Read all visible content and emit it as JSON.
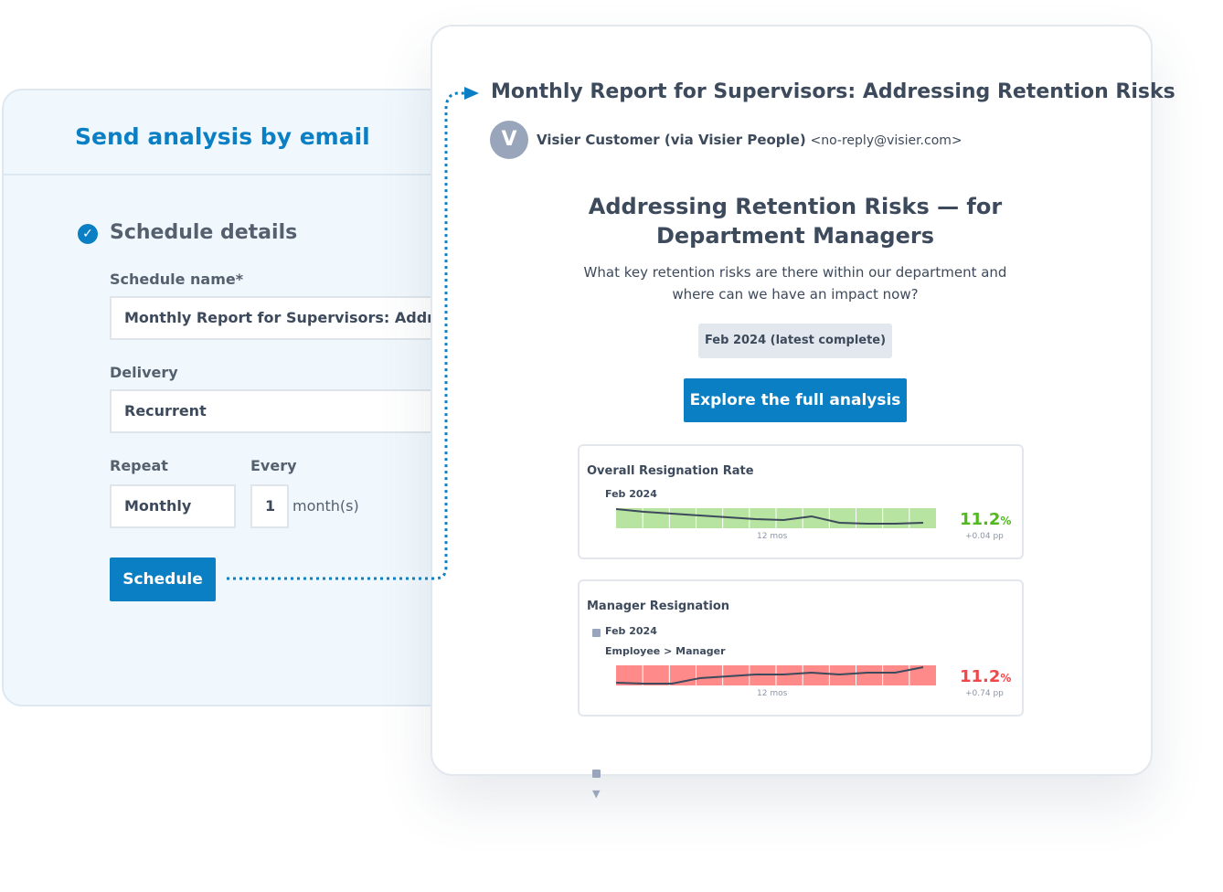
{
  "panel": {
    "title": "Send analysis by email",
    "section": "Schedule details",
    "name_label": "Schedule name*",
    "name_value": "Monthly Report for Supervisors: Addres...",
    "delivery_label": "Delivery",
    "delivery_value": "Recurrent",
    "repeat_label": "Repeat",
    "repeat_value": "Monthly",
    "every_label": "Every",
    "every_value": "1",
    "every_unit": "month(s)",
    "schedule_button": "Schedule"
  },
  "email": {
    "subject": "Monthly Report for Supervisors: Addressing Retention Risks",
    "avatar_letter": "V",
    "sender": "Visier Customer (via Visier People)",
    "sender_email": "<no-reply@visier.com>",
    "heading_line1": "Addressing Retention Risks — for",
    "heading_line2": "Department Managers",
    "question_line1": "What key retention risks are there within our department and",
    "question_line2": "where can we have an impact now?",
    "period": "Feb 2024 (latest complete)",
    "explore_button": "Explore the full analysis",
    "metrics": [
      {
        "title": "Overall Resignation Rate",
        "date": "Feb 2024",
        "filter": "",
        "range": "12 mos",
        "value": "11.2",
        "unit": "%",
        "change": "+0.04 pp",
        "color": "#52b81f",
        "band": "#b7e4a0"
      },
      {
        "title": "Manager Resignation",
        "date": "Feb 2024",
        "filter": "Employee > Manager",
        "range": "12 mos",
        "value": "11.2",
        "unit": "%",
        "change": "+0.74 pp",
        "color": "#f0474b",
        "band": "#ff8a8a"
      }
    ]
  },
  "colors": {
    "accent": "#0b7fc4"
  }
}
